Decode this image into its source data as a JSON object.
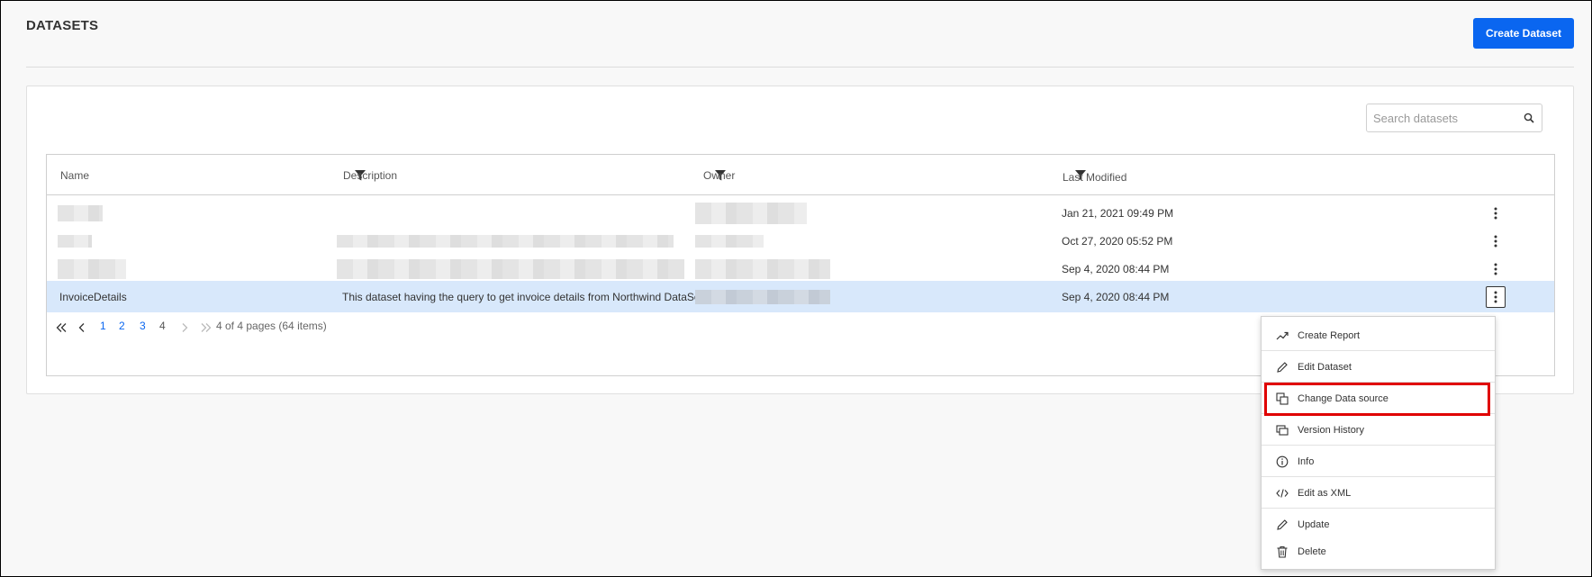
{
  "header": {
    "title": "DATASETS",
    "create_button": "Create Dataset"
  },
  "search": {
    "placeholder": "Search datasets",
    "value": ""
  },
  "table": {
    "columns": [
      "Name",
      "Description",
      "Owner",
      "Last Modified"
    ],
    "rows": [
      {
        "name": "",
        "description": "",
        "owner": "",
        "last_modified": "Jan 21, 2021 09:49 PM",
        "selected": false
      },
      {
        "name": "",
        "description": "",
        "owner": "",
        "last_modified": "Oct 27, 2020 05:52 PM",
        "selected": false
      },
      {
        "name": "",
        "description": "",
        "owner": "",
        "last_modified": "Sep 4, 2020 08:44 PM",
        "selected": false
      },
      {
        "name": "InvoiceDetails",
        "description": "This dataset having the query to get invoice details from Northwind DataSource.",
        "owner": "",
        "last_modified": "Sep 4, 2020 08:44 PM",
        "selected": true
      }
    ]
  },
  "pager": {
    "pages": [
      "1",
      "2",
      "3",
      "4"
    ],
    "current_page": "4",
    "info": "4 of 4 pages (64 items)"
  },
  "context_menu": {
    "items": [
      {
        "label": "Create Report",
        "icon": "trend-up-icon"
      },
      {
        "label": "Edit Dataset",
        "icon": "pencil-icon"
      },
      {
        "label": "Change Data source",
        "icon": "change-source-icon",
        "highlighted": true
      },
      {
        "label": "Version History",
        "icon": "version-history-icon"
      },
      {
        "label": "Info",
        "icon": "info-icon"
      },
      {
        "label": "Edit as XML",
        "icon": "code-icon"
      },
      {
        "label": "Update",
        "icon": "pencil-icon"
      },
      {
        "label": "Delete",
        "icon": "trash-icon"
      }
    ]
  },
  "colors": {
    "accent": "#0a66f0",
    "selected_row": "#d8e8fb",
    "highlight": "#e00000"
  }
}
